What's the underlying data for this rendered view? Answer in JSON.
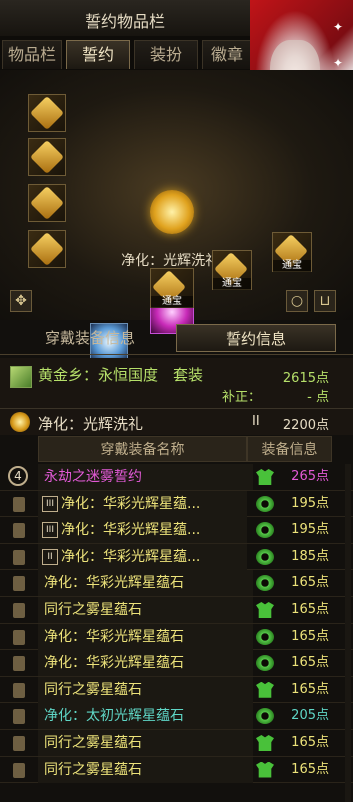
{
  "window": {
    "title": "誓约物品栏"
  },
  "tabs": [
    "物品栏",
    "誓约",
    "装扮",
    "徽章"
  ],
  "active_tab": "誓约",
  "equipped": {
    "center_name": "净化：光辉洗礼 II",
    "slot_label": "通宝"
  },
  "subtabs": [
    "穿戴装备信息",
    "誓约信息"
  ],
  "active_subtab": "誓约信息",
  "set": {
    "name": "黄金乡：永恒国度　套装",
    "points": "2615点",
    "correction_label": "补正：",
    "correction_value": "- 点"
  },
  "rite": {
    "name": "净化：光辉洗礼",
    "tier": "II",
    "points": "2200点"
  },
  "table": {
    "headers": [
      "穿戴装备名称",
      "装备信息"
    ],
    "rows": [
      {
        "name": "永劫之迷雾誓约",
        "tag": "",
        "lead": "4",
        "points": "265点",
        "color": "#e25ad6",
        "icon": "armor"
      },
      {
        "name": "净化：华彩光辉星蕴...",
        "tag": "III",
        "lead": "",
        "points": "195点",
        "color": "#ece27a",
        "icon": "ring"
      },
      {
        "name": "净化：华彩光辉星蕴...",
        "tag": "III",
        "lead": "",
        "points": "195点",
        "color": "#ece27a",
        "icon": "ring"
      },
      {
        "name": "净化：华彩光辉星蕴...",
        "tag": "II",
        "lead": "",
        "points": "185点",
        "color": "#ece27a",
        "icon": "ring"
      },
      {
        "name": "净化：华彩光辉星蕴石",
        "tag": "",
        "lead": "",
        "points": "165点",
        "color": "#ece27a",
        "icon": "ring"
      },
      {
        "name": "同行之雾星蕴石",
        "tag": "",
        "lead": "",
        "points": "165点",
        "color": "#ece27a",
        "icon": "armor"
      },
      {
        "name": "净化：华彩光辉星蕴石",
        "tag": "",
        "lead": "",
        "points": "165点",
        "color": "#ece27a",
        "icon": "ring"
      },
      {
        "name": "净化：华彩光辉星蕴石",
        "tag": "",
        "lead": "",
        "points": "165点",
        "color": "#ece27a",
        "icon": "ring"
      },
      {
        "name": "同行之雾星蕴石",
        "tag": "",
        "lead": "",
        "points": "165点",
        "color": "#ece27a",
        "icon": "armor"
      },
      {
        "name": "净化：太初光辉星蕴石",
        "tag": "",
        "lead": "",
        "points": "205点",
        "color": "#5fd6c6",
        "icon": "ring"
      },
      {
        "name": "同行之雾星蕴石",
        "tag": "",
        "lead": "",
        "points": "165点",
        "color": "#ece27a",
        "icon": "armor"
      },
      {
        "name": "同行之雾星蕴石",
        "tag": "",
        "lead": "",
        "points": "165点",
        "color": "#ece27a",
        "icon": "armor"
      }
    ]
  },
  "colors": {
    "accent_gold": "#e0a21e",
    "green": "#b6e06a",
    "pink": "#e25ad6",
    "cyan": "#5fd6c6"
  }
}
